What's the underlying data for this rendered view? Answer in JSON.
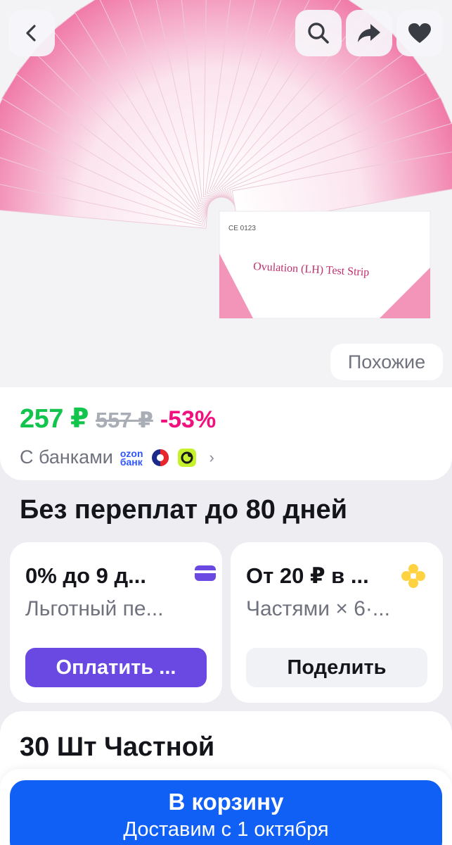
{
  "hero": {
    "strip_text": "Ovulation (LH) Test Strip",
    "ce_mark": "CE 0123",
    "similar_label": "Похожие"
  },
  "price": {
    "current": "257 ₽",
    "old": "557 ₽",
    "discount": "-53%",
    "banks_label": "С банками",
    "ozon_bank_line1": "ozon",
    "ozon_bank_line2": "банк"
  },
  "installments": {
    "title": "Без переплат до 80 дней",
    "left_card": {
      "heading": "0% до 9 д...",
      "subtitle": "Льготный пе...",
      "action": "Оплатить ..."
    },
    "right_card": {
      "heading": "От 20 ₽ в ...",
      "subtitle": "Частями × 6·...",
      "action": "Поделить"
    }
  },
  "product": {
    "title": "30 Шт Частной"
  },
  "cart": {
    "button_label": "В корзину",
    "delivery": "Доставим с 1 октября"
  },
  "colors": {
    "price_green": "#10c44c",
    "discount_pink": "#f1117e",
    "cart_blue": "#1160f6",
    "pay_purple": "#6a49e3"
  },
  "icons": {
    "back": "chevron-left-icon",
    "search": "search-icon",
    "share": "share-icon",
    "favorite": "heart-icon",
    "card": "card-icon",
    "dolyami": "flower-icon"
  }
}
